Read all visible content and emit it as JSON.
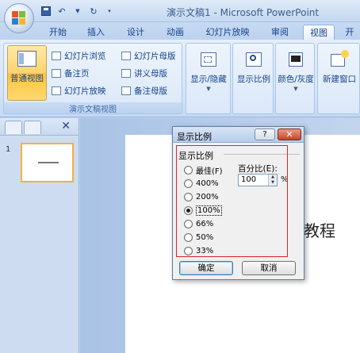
{
  "window": {
    "title": "演示文稿1 - Microsoft PowerPoint"
  },
  "quick_access": {
    "save_icon": "save-icon",
    "undo_icon": "undo-icon",
    "redo_icon": "redo-icon"
  },
  "tabs": [
    {
      "label": "开始"
    },
    {
      "label": "插入"
    },
    {
      "label": "设计"
    },
    {
      "label": "动画"
    },
    {
      "label": "幻灯片放映"
    },
    {
      "label": "审阅"
    },
    {
      "label": "视图"
    },
    {
      "label": "开"
    }
  ],
  "ribbon": {
    "presentation_views": {
      "group_label": "演示文稿视图",
      "normal_view": "普通视图",
      "slide_sorter": "幻灯片浏览",
      "notes_page": "备注页",
      "slide_show": "幻灯片放映",
      "slide_master": "幻灯片母版",
      "handout_master": "讲义母版",
      "notes_master": "备注母版"
    },
    "show_hide": "显示/隐藏",
    "zoom": "显示比例",
    "color_grayscale": "颜色/灰度",
    "new_window": "新建窗口"
  },
  "slide": {
    "text": "教程"
  },
  "zoom_dialog": {
    "title": "显示比例",
    "help_label": "?",
    "close_label": "✕",
    "group_title": "显示比例",
    "options": [
      {
        "label": "最佳(F)",
        "checked": false
      },
      {
        "label": "400%",
        "checked": false
      },
      {
        "label": "200%",
        "checked": false
      },
      {
        "label": "100%",
        "checked": true
      },
      {
        "label": "66%",
        "checked": false
      },
      {
        "label": "50%",
        "checked": false
      },
      {
        "label": "33%",
        "checked": false
      }
    ],
    "percent_label": "百分比(E):",
    "percent_value": "100",
    "percent_sign": "%",
    "ok_label": "确定",
    "cancel_label": "取消"
  },
  "left_pane": {
    "slide_number": "1"
  },
  "colors": {
    "highlight_border": "#e0242a",
    "selected_button": "#ffd36a",
    "ribbon_text": "#15428b"
  }
}
